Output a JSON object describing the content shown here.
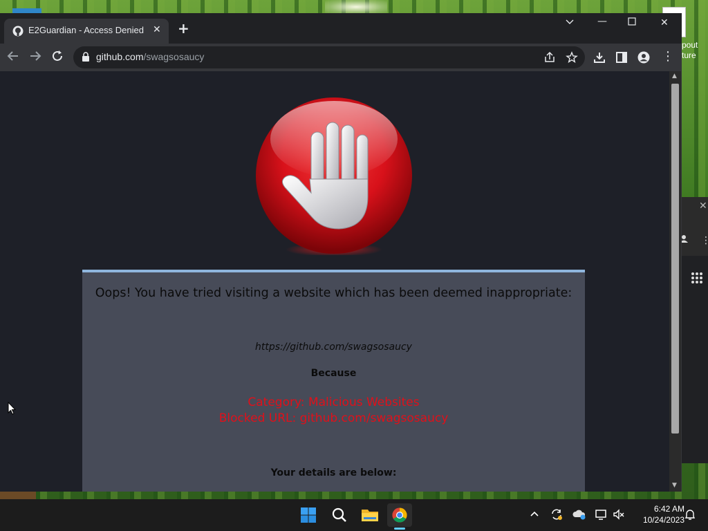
{
  "desktop": {
    "right_window_text": [
      "pout",
      "ture"
    ]
  },
  "browser": {
    "tab": {
      "title": "E2Guardian - Access Denied",
      "favicon": "github-icon"
    },
    "address": {
      "host": "github.com",
      "path": "/swagsosaucy"
    },
    "colors": {
      "tabstrip": "#202124",
      "toolbar": "#35363a",
      "page_bg": "#1e2028"
    }
  },
  "page": {
    "heading": "Oops! You have tried visiting a website which has been deemed inappropriate:",
    "blocked_url": "https://github.com/swagsosaucy",
    "because_label": "Because",
    "category_line": "Category: Malicious Websites",
    "blocked_line": "Blocked URL: github.com/swagsosaucy",
    "details_label": "Your details are below:",
    "colors": {
      "panel": "#474b58",
      "panel_border": "#8fb6dd",
      "reason_text": "#e0101a",
      "stop_red": "#e3141b"
    }
  },
  "taskbar": {
    "apps": [
      "start-icon",
      "search-icon",
      "file-explorer-icon",
      "chrome-icon"
    ],
    "time": "6:42 AM",
    "date": "10/24/2023",
    "accent": "#60cdff"
  }
}
